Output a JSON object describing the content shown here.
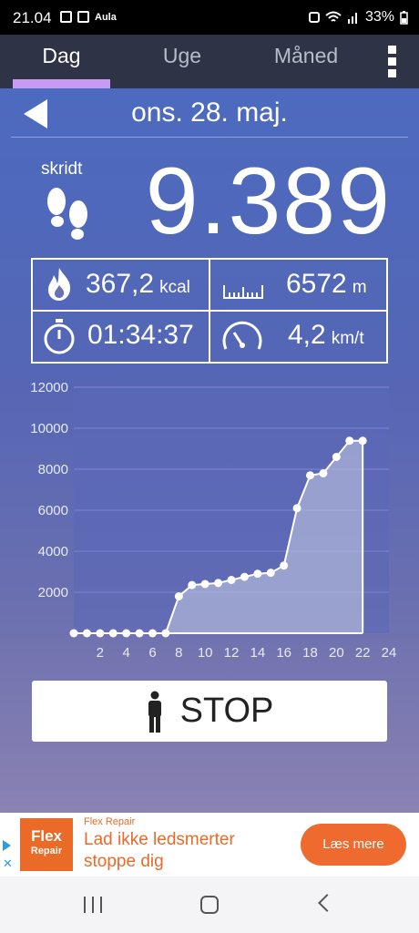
{
  "status_bar": {
    "time": "21.04",
    "app_badge": "Aula",
    "battery": "33%"
  },
  "tabs": [
    {
      "label": "Dag",
      "active": true
    },
    {
      "label": "Uge",
      "active": false
    },
    {
      "label": "Måned",
      "active": false
    }
  ],
  "day": {
    "date": "ons. 28. maj.",
    "steps_label": "skridt",
    "steps": "9.389"
  },
  "stats": {
    "calories": {
      "value": "367,2",
      "unit": "kcal",
      "icon": "flame-icon"
    },
    "distance": {
      "value": "6572",
      "unit": "m",
      "icon": "ruler-icon"
    },
    "duration": {
      "value": "01:34:37",
      "icon": "stopwatch-icon"
    },
    "speed": {
      "value": "4,2",
      "unit": "km/t",
      "icon": "speedometer-icon"
    }
  },
  "chart_data": {
    "type": "area",
    "x": [
      0,
      1,
      2,
      3,
      4,
      5,
      6,
      7,
      8,
      9,
      10,
      11,
      12,
      13,
      14,
      15,
      16,
      17,
      18,
      19,
      20,
      21,
      22
    ],
    "values": [
      0,
      0,
      0,
      0,
      0,
      0,
      0,
      0,
      1800,
      2350,
      2400,
      2450,
      2600,
      2750,
      2900,
      2950,
      3300,
      6100,
      7700,
      7800,
      8600,
      9389,
      9389
    ],
    "xticks": [
      2,
      4,
      6,
      8,
      10,
      12,
      14,
      16,
      18,
      20,
      22,
      24
    ],
    "yticks": [
      2000,
      4000,
      6000,
      8000,
      10000,
      12000
    ],
    "xlim": [
      0,
      24
    ],
    "ylim": [
      0,
      12000
    ],
    "grid": true,
    "colors": {
      "line": "#ffffff",
      "fill": "#c8cde3",
      "grid": "#6d77c4",
      "tick": "#e8ebf7"
    }
  },
  "stop_button": {
    "label": "STOP",
    "icon": "person-icon"
  },
  "ad": {
    "logo_line1": "Flex",
    "logo_line2": "Repair",
    "brand": "Flex Repair",
    "title": "Lad ikke ledsmerter stoppe dig",
    "cta": "Læs mere"
  }
}
